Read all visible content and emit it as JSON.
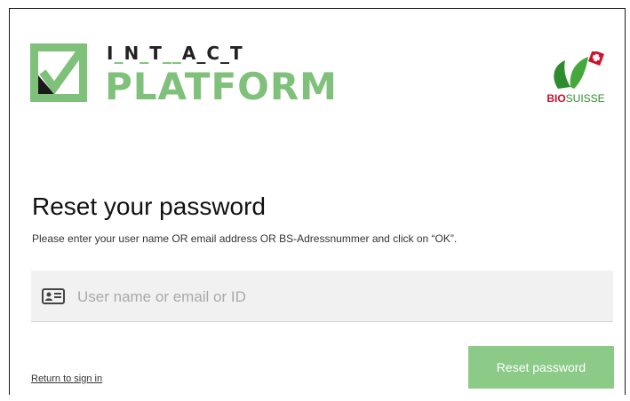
{
  "brand": {
    "intact_parts": [
      "I",
      "N",
      "T",
      "A",
      "C",
      "T"
    ],
    "intact_separators": [
      "_",
      "_",
      "__",
      "_",
      "_"
    ],
    "platform": "PLATFORM",
    "accent_color": "#7fc17a",
    "partner_logo": {
      "bio": "BIO",
      "suisse": "SUISSE"
    }
  },
  "page": {
    "title": "Reset your password",
    "instructions": "Please enter your user name OR email address OR BS-Adressnummer and click on “OK”."
  },
  "form": {
    "identifier_placeholder": "User name or email or ID",
    "identifier_value": "",
    "id_icon": "id-card-icon",
    "submit_label": "Reset password",
    "button_color": "#8ccb87"
  },
  "footer": {
    "return_link": "Return to sign in"
  }
}
